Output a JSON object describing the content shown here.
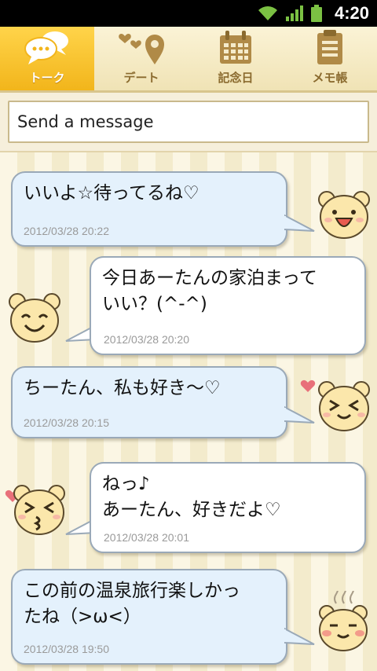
{
  "status_bar": {
    "time": "4:20"
  },
  "tabs": [
    {
      "label": "トーク",
      "icon": "speech-bubbles-icon",
      "active": true
    },
    {
      "label": "デート",
      "icon": "hearts-location-pin-icon",
      "active": false
    },
    {
      "label": "記念日",
      "icon": "calendar-icon",
      "active": false
    },
    {
      "label": "メモ帳",
      "icon": "notepad-icon",
      "active": false
    }
  ],
  "input": {
    "placeholder": "Send a message"
  },
  "messages": [
    {
      "side": "left",
      "text": "いいよ☆待ってるね♡",
      "timestamp": "2012/03/28 20:22",
      "avatar": "bear-happy-icon"
    },
    {
      "side": "right",
      "text": "今日あーたんの家泊まって\nいい？(^-^)",
      "timestamp": "2012/03/28 20:20",
      "avatar": "bear-smile-icon"
    },
    {
      "side": "left",
      "text": "ちーたん、私も好き～♡",
      "timestamp": "2012/03/28 20:15",
      "avatar": "bear-wink-icon"
    },
    {
      "side": "right",
      "text": "ねっ♪\nあーたん、好きだよ♡",
      "timestamp": "2012/03/28 20:01",
      "avatar": "bear-kiss-icon"
    },
    {
      "side": "left",
      "text": "この前の温泉旅行楽しかっ\nたね（>ω<）",
      "timestamp": "2012/03/28 19:50",
      "avatar": "bear-onsen-icon"
    }
  ],
  "colors": {
    "accent": "#f5bd25",
    "bubble_left": "#e4f1fc",
    "bubble_right": "#ffffff",
    "tab_text": "#8a6a2e"
  }
}
